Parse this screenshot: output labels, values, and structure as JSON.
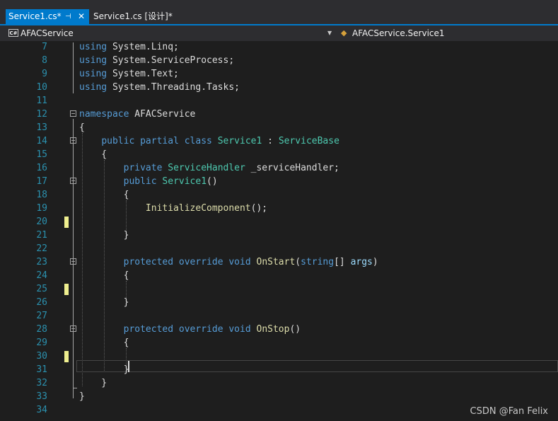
{
  "tabs": [
    {
      "label": "Service1.cs*",
      "active": true
    },
    {
      "label": "Service1.cs [设计]*",
      "active": false
    }
  ],
  "tab_pin_icon": "pin-icon",
  "tab_close_icon": "close-icon",
  "navbar": {
    "project_icon_text": "C#",
    "project": "AFACService",
    "member": "AFACService.Service1"
  },
  "editor": {
    "lines": [
      {
        "n": "7",
        "tokens": [
          {
            "t": "using",
            "c": "kw"
          },
          {
            "t": " System.Linq;"
          }
        ]
      },
      {
        "n": "8",
        "tokens": [
          {
            "t": "using",
            "c": "kw"
          },
          {
            "t": " System.ServiceProcess;"
          }
        ]
      },
      {
        "n": "9",
        "tokens": [
          {
            "t": "using",
            "c": "kw"
          },
          {
            "t": " System.Text;"
          }
        ]
      },
      {
        "n": "10",
        "tokens": [
          {
            "t": "using",
            "c": "kw"
          },
          {
            "t": " System.Threading.Tasks;"
          }
        ]
      },
      {
        "n": "11",
        "tokens": []
      },
      {
        "n": "12",
        "tokens": [
          {
            "t": "namespace",
            "c": "kw"
          },
          {
            "t": " AFACService"
          }
        ]
      },
      {
        "n": "13",
        "tokens": [
          {
            "t": "{"
          }
        ]
      },
      {
        "n": "14",
        "tokens": [
          {
            "t": "    "
          },
          {
            "t": "public",
            "c": "kw"
          },
          {
            "t": " "
          },
          {
            "t": "partial",
            "c": "kw"
          },
          {
            "t": " "
          },
          {
            "t": "class",
            "c": "kw"
          },
          {
            "t": " "
          },
          {
            "t": "Service1",
            "c": "ty"
          },
          {
            "t": " : "
          },
          {
            "t": "ServiceBase",
            "c": "ty"
          }
        ]
      },
      {
        "n": "15",
        "tokens": [
          {
            "t": "    {"
          }
        ]
      },
      {
        "n": "16",
        "tokens": [
          {
            "t": "        "
          },
          {
            "t": "private",
            "c": "kw"
          },
          {
            "t": " "
          },
          {
            "t": "ServiceHandler",
            "c": "ty"
          },
          {
            "t": " _serviceHandler;"
          }
        ]
      },
      {
        "n": "17",
        "tokens": [
          {
            "t": "        "
          },
          {
            "t": "public",
            "c": "kw"
          },
          {
            "t": " "
          },
          {
            "t": "Service1",
            "c": "ty"
          },
          {
            "t": "()"
          }
        ]
      },
      {
        "n": "18",
        "tokens": [
          {
            "t": "        {"
          }
        ]
      },
      {
        "n": "19",
        "tokens": [
          {
            "t": "            "
          },
          {
            "t": "InitializeComponent",
            "c": "fn"
          },
          {
            "t": "();"
          }
        ]
      },
      {
        "n": "20",
        "tokens": []
      },
      {
        "n": "21",
        "tokens": [
          {
            "t": "        }"
          }
        ]
      },
      {
        "n": "22",
        "tokens": []
      },
      {
        "n": "23",
        "tokens": [
          {
            "t": "        "
          },
          {
            "t": "protected",
            "c": "kw"
          },
          {
            "t": " "
          },
          {
            "t": "override",
            "c": "kw"
          },
          {
            "t": " "
          },
          {
            "t": "void",
            "c": "kw"
          },
          {
            "t": " "
          },
          {
            "t": "OnStart",
            "c": "fn"
          },
          {
            "t": "("
          },
          {
            "t": "string",
            "c": "kw"
          },
          {
            "t": "[] "
          },
          {
            "t": "args",
            "c": "id"
          },
          {
            "t": ")"
          }
        ]
      },
      {
        "n": "24",
        "tokens": [
          {
            "t": "        {"
          }
        ]
      },
      {
        "n": "25",
        "tokens": []
      },
      {
        "n": "26",
        "tokens": [
          {
            "t": "        }"
          }
        ]
      },
      {
        "n": "27",
        "tokens": []
      },
      {
        "n": "28",
        "tokens": [
          {
            "t": "        "
          },
          {
            "t": "protected",
            "c": "kw"
          },
          {
            "t": " "
          },
          {
            "t": "override",
            "c": "kw"
          },
          {
            "t": " "
          },
          {
            "t": "void",
            "c": "kw"
          },
          {
            "t": " "
          },
          {
            "t": "OnStop",
            "c": "fn"
          },
          {
            "t": "()"
          }
        ]
      },
      {
        "n": "29",
        "tokens": [
          {
            "t": "        {"
          }
        ]
      },
      {
        "n": "30",
        "tokens": []
      },
      {
        "n": "31",
        "tokens": [
          {
            "t": "        }"
          }
        ]
      },
      {
        "n": "32",
        "tokens": [
          {
            "t": "    }"
          }
        ]
      },
      {
        "n": "33",
        "tokens": [
          {
            "t": "}"
          }
        ]
      },
      {
        "n": "34",
        "tokens": []
      }
    ],
    "changed_lines": [
      "20",
      "25",
      "30"
    ],
    "fold_lines": [
      "12",
      "14",
      "17",
      "23",
      "28"
    ],
    "current_line": "31"
  },
  "colors": {
    "keyword": "#569cd6",
    "type": "#4ec9b0",
    "method": "#dcdcaa",
    "parameter": "#9cdcfe",
    "plain": "#dcdcdc",
    "line_number": "#2b91af",
    "change_marker": "#efef8f",
    "accent": "#007acc"
  },
  "watermark": "CSDN @Fan Felix"
}
